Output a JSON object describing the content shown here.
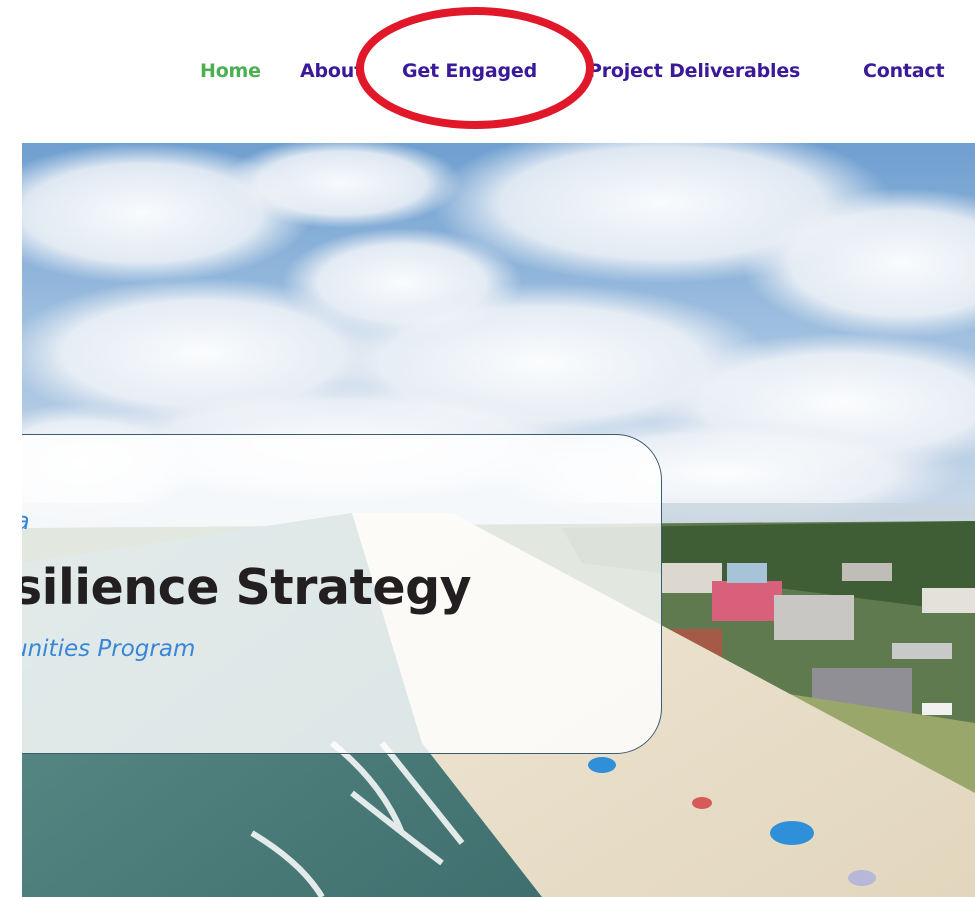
{
  "nav": {
    "items": [
      {
        "label": "Home",
        "color": "#4caf50"
      },
      {
        "label": "About",
        "color": "#3b1a9a"
      },
      {
        "label": "Get Engaged",
        "color": "#3b1a9a"
      },
      {
        "label": "Project Deliverables",
        "color": "#3b1a9a"
      },
      {
        "label": "Contact",
        "color": "#3b1a9a"
      }
    ],
    "highlight_color": "#e0182a"
  },
  "hero": {
    "image": "aerial-beach-town-photo",
    "eyebrow": "a",
    "title": "silience Strategy",
    "subtitle": "unities Program"
  },
  "colors": {
    "nav_active": "#4caf50",
    "nav_link": "#3b1a9a",
    "title": "#231f20",
    "accent_blue": "#3a86d6",
    "card_border": "#3a5c6e"
  }
}
